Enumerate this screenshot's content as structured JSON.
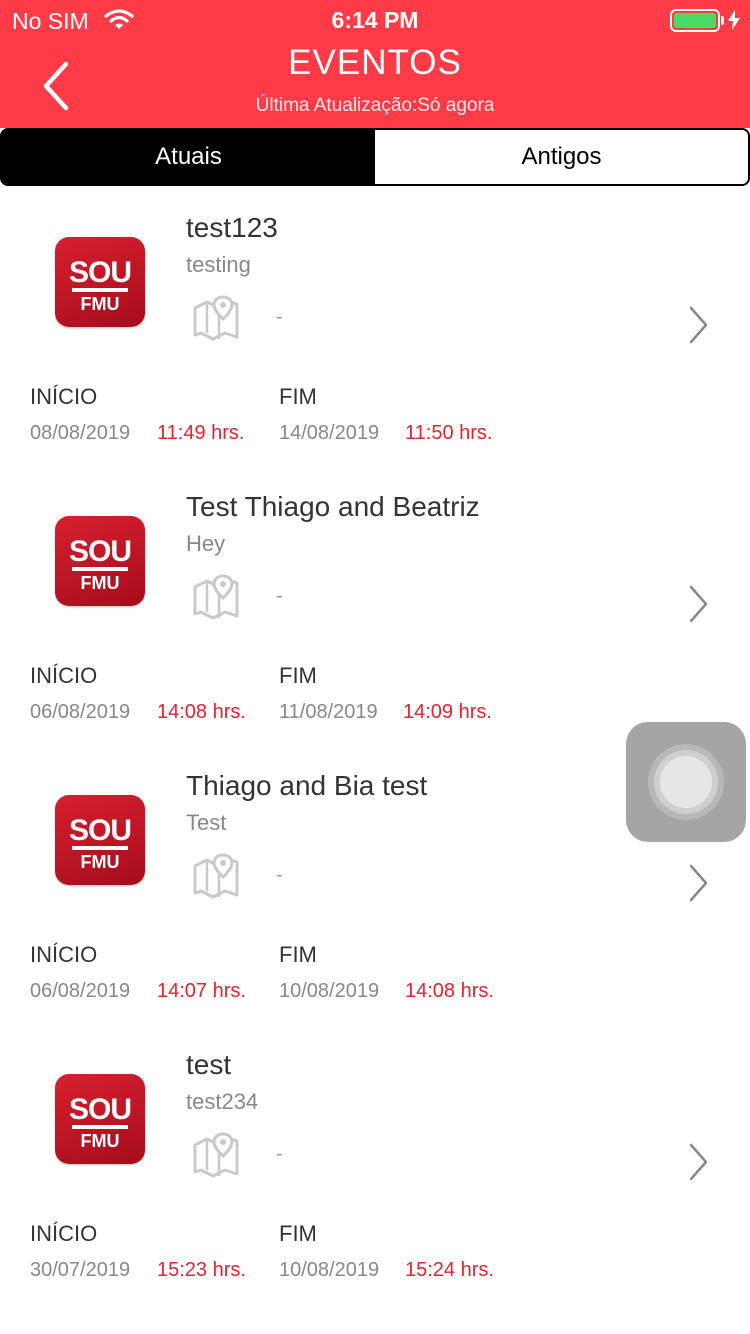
{
  "status_bar": {
    "carrier": "No SIM",
    "time": "6:14 PM"
  },
  "header": {
    "title": "EVENTOS",
    "subtitle": "Última Atualização:Só agora"
  },
  "segments": [
    {
      "label": "Atuais",
      "active": true
    },
    {
      "label": "Antigos",
      "active": false
    }
  ],
  "labels": {
    "start": "INÍCIO",
    "end": "FIM"
  },
  "events": [
    {
      "name": "test123",
      "description": "testing",
      "location": "-",
      "start_date": "08/08/2019",
      "start_time": "11:49 hrs.",
      "end_date": "14/08/2019",
      "end_time": "11:50 hrs."
    },
    {
      "name": "Test Thiago and Beatriz",
      "description": "Hey",
      "location": "-",
      "start_date": "06/08/2019",
      "start_time": "14:08 hrs.",
      "end_date": "11/08/2019",
      "end_time": "14:09 hrs."
    },
    {
      "name": "Thiago and Bia test",
      "description": "Test",
      "location": "-",
      "start_date": "06/08/2019",
      "start_time": "14:07 hrs.",
      "end_date": "10/08/2019",
      "end_time": "14:08 hrs."
    },
    {
      "name": "test",
      "description": "test234",
      "location": "-",
      "start_date": "30/07/2019",
      "start_time": "15:23 hrs.",
      "end_date": "10/08/2019",
      "end_time": "15:24 hrs."
    }
  ],
  "logo_text": {
    "line1": "SOU",
    "line2": "FMU"
  },
  "colors": {
    "header": "#ff3b47",
    "time_accent": "#e5232f",
    "battery": "#4cd964",
    "logo": "#c0172a"
  },
  "icons": {
    "back": "chevron-left-icon",
    "map": "map-pin-icon",
    "row_arrow": "chevron-right-icon",
    "assistive": "assistive-touch-icon"
  }
}
